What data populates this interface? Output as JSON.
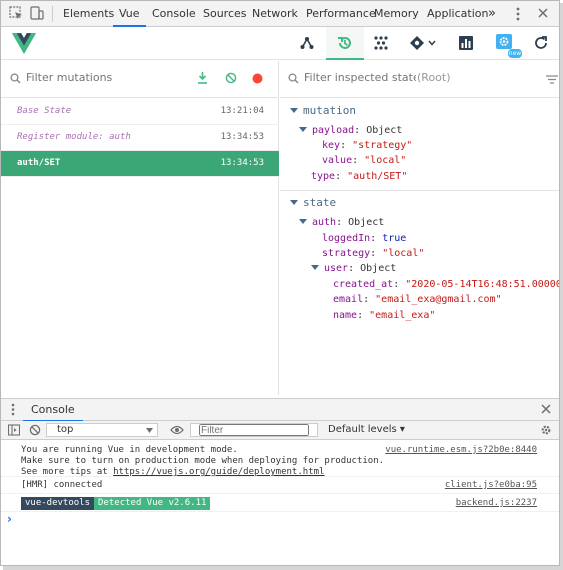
{
  "devtools": {
    "tabs": [
      "Elements",
      "Vue",
      "Console",
      "Sources",
      "Network",
      "Performance",
      "Memory",
      "Application"
    ],
    "active_tab": "Vue",
    "more_label": "»"
  },
  "vue_toolbar": {
    "tools": [
      "components-icon",
      "history-icon",
      "vuex-icon",
      "events-icon",
      "performance-icon",
      "settings-icon",
      "refresh-icon"
    ],
    "active_tool": "history-icon",
    "new_badge": "new",
    "accent": "#42b983"
  },
  "mutations": {
    "filter_placeholder": "Filter mutations",
    "items": [
      {
        "name": "Base State",
        "time": "13:21:04"
      },
      {
        "name": "Register module: auth",
        "time": "13:34:53"
      },
      {
        "name": "auth/SET",
        "time": "13:34:53"
      }
    ],
    "selected_index": 2,
    "selected_color": "#3ba776"
  },
  "inspector": {
    "filter_placeholder": "Filter inspected state",
    "root_label": "(Root)",
    "mutation_section": "mutation",
    "state_section": "state",
    "payload_key": "payload",
    "payload_type": "Object",
    "payload_key_key": "key",
    "payload_key_value": "\"strategy\"",
    "payload_value_key": "value",
    "payload_value_value": "\"local\"",
    "type_key": "type",
    "type_value": "\"auth/SET\"",
    "auth_key": "auth",
    "auth_type": "Object",
    "loggedin_key": "loggedIn",
    "loggedin_value": "true",
    "strategy_key": "strategy",
    "strategy_value": "\"local\"",
    "user_key": "user",
    "user_type": "Object",
    "created_key": "created_at",
    "created_value": "\"2020-05-14T16:48:51.000000",
    "email_key": "email",
    "email_value": "\"email_exa@gmail.com\"",
    "name_key": "name",
    "name_value": "\"email_exa\""
  },
  "console": {
    "tab_label": "Console",
    "context": "top",
    "filter_placeholder": "Filter",
    "levels": "Default levels ▾",
    "msg1_line1": "You are running Vue in development mode.",
    "msg1_line2": "Make sure to turn on production mode when deploying for production.",
    "msg1_line3_prefix": "See more tips at ",
    "msg1_link": "https://vuejs.org/guide/deployment.html",
    "msg1_source": "vue.runtime.esm.js?2b0e:8440",
    "msg2_text": "[HMR] connected",
    "msg2_source": "client.js?e0ba:95",
    "msg3_chip1": "vue-devtools",
    "msg3_chip2": "Detected Vue v2.6.11",
    "msg3_source": "backend.js:2237",
    "prompt": "›",
    "chip1_color": "#35495e",
    "chip2_color": "#41b883"
  }
}
